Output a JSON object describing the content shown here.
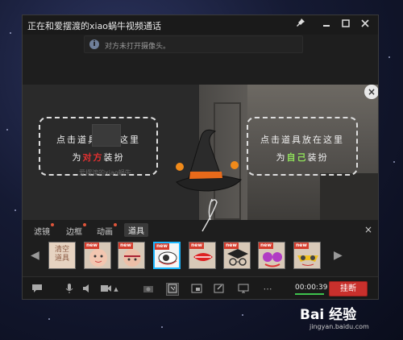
{
  "window": {
    "title": "正在和爱摆渡的xiao蜗牛视频通话",
    "pin_icon": "pin-icon",
    "min_icon": "minimize-icon",
    "max_icon": "maximize-icon",
    "close_icon": "close-icon"
  },
  "notice": {
    "icon": "info-icon",
    "text": "对方未打开摄像头。"
  },
  "tips": {
    "left": {
      "line1": "点击道具放在这里",
      "line2_prefix": "为",
      "line2_highlight": "对方",
      "line2_suffix": "装扮"
    },
    "right": {
      "line1": "点击道具放在这里",
      "line2_prefix": "为",
      "line2_highlight": "自己",
      "line2_suffix": "装扮"
    }
  },
  "avatar_name": "爱摆渡的xiao蜗牛",
  "tabs": [
    {
      "label": "滤镜",
      "has_dot": true
    },
    {
      "label": "边框",
      "has_dot": true
    },
    {
      "label": "动画",
      "has_dot": true
    },
    {
      "label": "道具",
      "has_dot": false,
      "active": true
    }
  ],
  "props": {
    "clear_label": "清空道具",
    "items": [
      {
        "name": "face-prop",
        "badge": "new"
      },
      {
        "name": "face2-prop",
        "badge": "new"
      },
      {
        "name": "eye-prop",
        "badge": "new",
        "selected": true
      },
      {
        "name": "lips-prop",
        "badge": "new"
      },
      {
        "name": "graduation-hat-prop",
        "badge": "new"
      },
      {
        "name": "glasses-prop",
        "badge": "new"
      },
      {
        "name": "party-glasses-prop",
        "badge": "new"
      }
    ],
    "new_badge": "new"
  },
  "controls": {
    "timer": "00:00:39",
    "hangup_label": "挂断"
  },
  "watermark": {
    "logo": "Bai 经验",
    "url": "jingyan.baidu.com"
  },
  "colors": {
    "accent": "#1cb7ff",
    "hangup": "#c9302c",
    "timer_bar": "#3ec24d"
  }
}
